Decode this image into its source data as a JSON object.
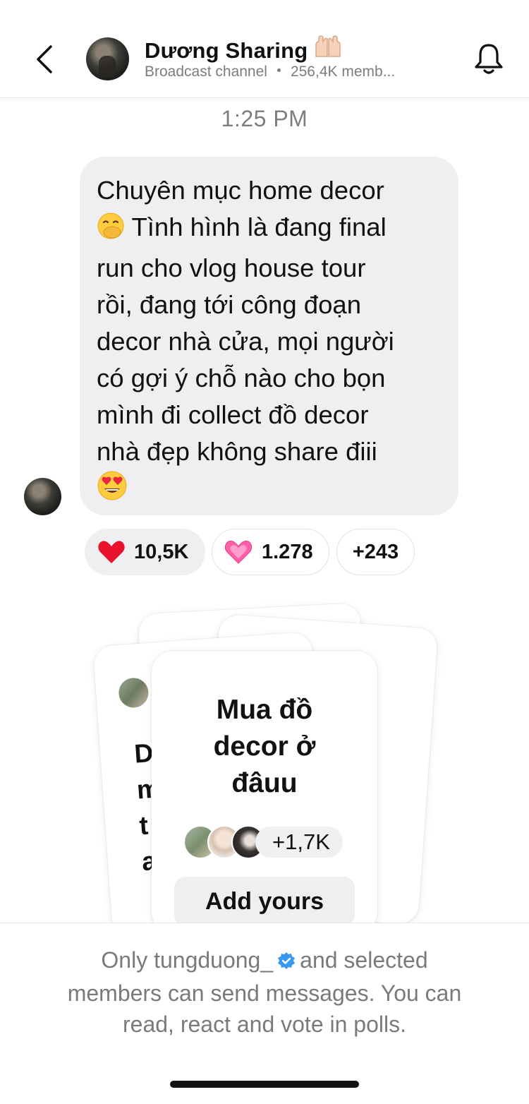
{
  "header": {
    "title": "Dương Sharing",
    "title_emoji": "raised-hands-icon",
    "subtitle_type": "Broadcast channel",
    "subtitle_members": "256,4K memb..."
  },
  "timestamp": "1:25 PM",
  "message": {
    "line1": "Chuyên mục home decor",
    "line2": "Tình hình là đang final",
    "line3": "run cho vlog house tour",
    "line4": "rồi, đang tới công đoạn",
    "line5": "decor nhà cửa, mọi người",
    "line6": "có gợi ý chỗ nào cho bọn",
    "line7": "mình đi collect đồ decor",
    "line8": "nhà đẹp không share điii",
    "emoji_inline": "hand-over-mouth-emoji",
    "emoji_end": "heart-eyes-emoji"
  },
  "reactions": [
    {
      "icon": "red-heart-icon",
      "count": "10,5K"
    },
    {
      "icon": "sparkling-heart-icon",
      "count": "1.278"
    },
    {
      "icon": "",
      "count": "+243"
    }
  ],
  "prompt_card": {
    "question_l1": "Mua đồ",
    "question_l2": "decor ở",
    "question_l3": "đâuu",
    "participant_count": "+1,7K",
    "button_label": "Add yours",
    "peek_lines": [
      "D",
      "m",
      "t",
      "a"
    ]
  },
  "footer": {
    "part1": "Only tungduong_",
    "part2": "and selected",
    "line2": "members can send messages. You can",
    "line3": "read, react and vote in polls."
  },
  "colors": {
    "bubble": "#efeff1",
    "muted_text": "#7a7a7a",
    "verified": "#3897f0"
  }
}
